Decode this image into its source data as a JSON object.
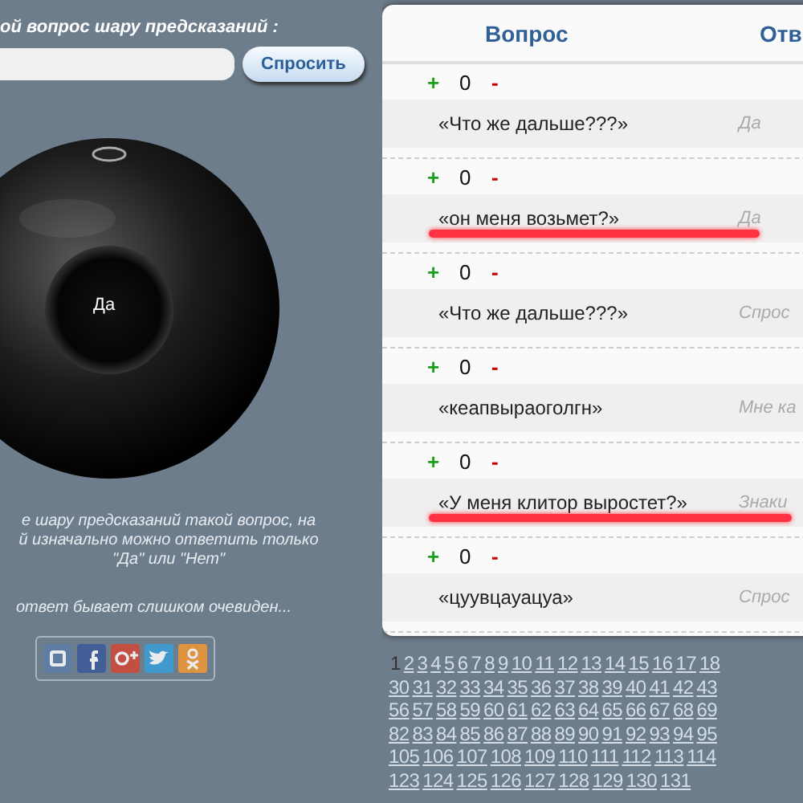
{
  "ask": {
    "label": "ой вопрос шару предсказаний :",
    "button": "Спросить"
  },
  "ball": {
    "answer": "Да"
  },
  "notes": [
    "е шару предсказаний такой вопрос, на\nй изначально можно ответить только\n\"Да\" или \"Нет\"",
    "ответ бывает слишком очевиден..."
  ],
  "table": {
    "columns": [
      "Вопрос",
      "Отв"
    ],
    "rows": [
      {
        "plus": "+",
        "score": "0",
        "minus": "-",
        "question": "«Что же дальше???»",
        "answer": "Да",
        "highlighted": false
      },
      {
        "plus": "+",
        "score": "0",
        "minus": "-",
        "question": "«он меня возьмет?»",
        "answer": "Да",
        "highlighted": true
      },
      {
        "plus": "+",
        "score": "0",
        "minus": "-",
        "question": "«Что же дальше???»",
        "answer": "Спрос",
        "highlighted": false
      },
      {
        "plus": "+",
        "score": "0",
        "minus": "-",
        "question": "«кеапвыраоголгн»",
        "answer": "Мне ка",
        "highlighted": false
      },
      {
        "plus": "+",
        "score": "0",
        "minus": "-",
        "question": "«У меня клитор выростет?»",
        "answer": "Знаки",
        "highlighted": true
      },
      {
        "plus": "+",
        "score": "0",
        "minus": "-",
        "question": "«цуувцауацуа»",
        "answer": "Спрос",
        "highlighted": false
      }
    ]
  },
  "pagination": [
    [
      {
        "label": "1",
        "selected": true
      },
      {
        "label": "2",
        "selected": false
      },
      {
        "label": "3",
        "selected": false
      },
      {
        "label": "4",
        "selected": false
      },
      {
        "label": "5",
        "selected": false
      },
      {
        "label": "6",
        "selected": false
      },
      {
        "label": "7",
        "selected": false
      },
      {
        "label": "8",
        "selected": false
      },
      {
        "label": "9",
        "selected": false
      },
      {
        "label": "10",
        "selected": false
      },
      {
        "label": "11",
        "selected": false
      },
      {
        "label": "12",
        "selected": false
      },
      {
        "label": "13",
        "selected": false
      },
      {
        "label": "14",
        "selected": false
      },
      {
        "label": "15",
        "selected": false
      },
      {
        "label": "16",
        "selected": false
      },
      {
        "label": "17",
        "selected": false
      },
      {
        "label": "18",
        "selected": false
      }
    ],
    [
      {
        "label": "30",
        "selected": false
      },
      {
        "label": "31",
        "selected": false
      },
      {
        "label": "32",
        "selected": false
      },
      {
        "label": "33",
        "selected": false
      },
      {
        "label": "34",
        "selected": false
      },
      {
        "label": "35",
        "selected": false
      },
      {
        "label": "36",
        "selected": false
      },
      {
        "label": "37",
        "selected": false
      },
      {
        "label": "38",
        "selected": false
      },
      {
        "label": "39",
        "selected": false
      },
      {
        "label": "40",
        "selected": false
      },
      {
        "label": "41",
        "selected": false
      },
      {
        "label": "42",
        "selected": false
      },
      {
        "label": "43",
        "selected": false
      }
    ],
    [
      {
        "label": "56",
        "selected": false
      },
      {
        "label": "57",
        "selected": false
      },
      {
        "label": "58",
        "selected": false
      },
      {
        "label": "59",
        "selected": false
      },
      {
        "label": "60",
        "selected": false
      },
      {
        "label": "61",
        "selected": false
      },
      {
        "label": "62",
        "selected": false
      },
      {
        "label": "63",
        "selected": false
      },
      {
        "label": "64",
        "selected": false
      },
      {
        "label": "65",
        "selected": false
      },
      {
        "label": "66",
        "selected": false
      },
      {
        "label": "67",
        "selected": false
      },
      {
        "label": "68",
        "selected": false
      },
      {
        "label": "69",
        "selected": false
      }
    ],
    [
      {
        "label": "82",
        "selected": false
      },
      {
        "label": "83",
        "selected": false
      },
      {
        "label": "84",
        "selected": false
      },
      {
        "label": "85",
        "selected": false
      },
      {
        "label": "86",
        "selected": false
      },
      {
        "label": "87",
        "selected": false
      },
      {
        "label": "88",
        "selected": false
      },
      {
        "label": "89",
        "selected": false
      },
      {
        "label": "90",
        "selected": false
      },
      {
        "label": "91",
        "selected": false
      },
      {
        "label": "92",
        "selected": false
      },
      {
        "label": "93",
        "selected": false
      },
      {
        "label": "94",
        "selected": false
      },
      {
        "label": "95",
        "selected": false
      }
    ],
    [
      {
        "label": "105",
        "selected": false
      },
      {
        "label": "106",
        "selected": false
      },
      {
        "label": "107",
        "selected": false
      },
      {
        "label": "108",
        "selected": false
      },
      {
        "label": "109",
        "selected": false
      },
      {
        "label": "110",
        "selected": false
      },
      {
        "label": "111",
        "selected": false
      },
      {
        "label": "112",
        "selected": false
      },
      {
        "label": "113",
        "selected": false
      },
      {
        "label": "114",
        "selected": false
      }
    ],
    [
      {
        "label": "123",
        "selected": false
      },
      {
        "label": "124",
        "selected": false
      },
      {
        "label": "125",
        "selected": false
      },
      {
        "label": "126",
        "selected": false
      },
      {
        "label": "127",
        "selected": false
      },
      {
        "label": "128",
        "selected": false
      },
      {
        "label": "129",
        "selected": false
      },
      {
        "label": "130",
        "selected": false
      },
      {
        "label": "131",
        "selected": false
      }
    ]
  ]
}
